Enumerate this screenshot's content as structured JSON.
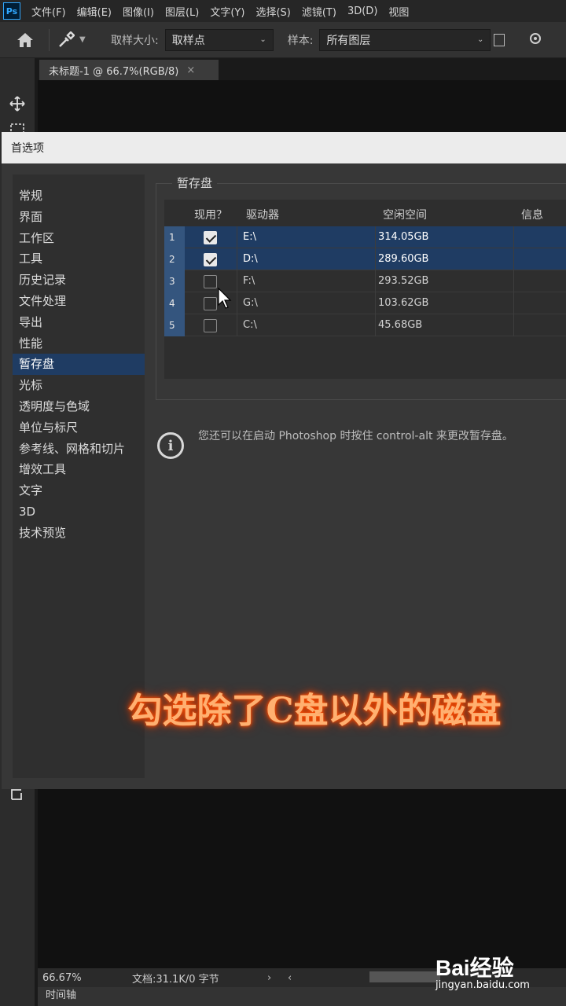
{
  "menubar": {
    "logo": "Ps",
    "items": [
      "文件(F)",
      "编辑(E)",
      "图像(I)",
      "图层(L)",
      "文字(Y)",
      "选择(S)",
      "滤镜(T)",
      "3D(D)",
      "视图"
    ]
  },
  "options": {
    "sample_size_label": "取样大小:",
    "sample_size_value": "取样点",
    "sample_label": "样本:",
    "sample_value": "所有图层"
  },
  "doc_tab": {
    "title": "未标题-1 @ 66.7%(RGB/8)",
    "close": "×"
  },
  "dialog": {
    "title": "首选项",
    "nav": [
      "常规",
      "界面",
      "工作区",
      "工具",
      "历史记录",
      "文件处理",
      "导出",
      "性能",
      "暂存盘",
      "光标",
      "透明度与色域",
      "单位与标尺",
      "参考线、网格和切片",
      "增效工具",
      "文字",
      "3D",
      "技术预览"
    ],
    "active_index": 8,
    "scratch": {
      "legend": "暂存盘",
      "headers": {
        "active": "现用？",
        "drive": "驱动器",
        "free": "空闲空间",
        "info": "信息"
      },
      "rows": [
        {
          "num": "1",
          "checked": true,
          "drive": "E:\\",
          "free": "314.05GB"
        },
        {
          "num": "2",
          "checked": true,
          "drive": "D:\\",
          "free": "289.60GB"
        },
        {
          "num": "3",
          "checked": false,
          "drive": "F:\\",
          "free": "293.52GB"
        },
        {
          "num": "4",
          "checked": false,
          "drive": "G:\\",
          "free": "103.62GB"
        },
        {
          "num": "5",
          "checked": false,
          "drive": "C:\\",
          "free": "45.68GB"
        }
      ]
    },
    "info_text": "您还可以在启动 Photoshop 时按住 control-alt 来更改暂存盘。"
  },
  "caption": "勾选除了C盘以外的磁盘",
  "status": {
    "zoom": "66.67%",
    "doc": "文档:31.1K/0 字节",
    "arrow_right": "›",
    "arrow_left": "‹",
    "timeline": "时间轴"
  },
  "watermark": {
    "logo": "Bai经验",
    "url": "jingyan.baidu.com"
  },
  "colors": {
    "selection": "#1f3c63",
    "caption_glow": "#ff5000"
  }
}
